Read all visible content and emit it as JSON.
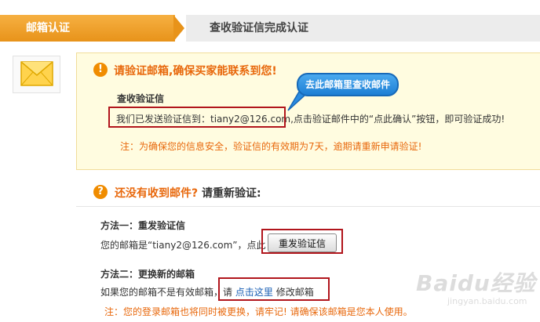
{
  "steps": {
    "step1": "邮箱认证",
    "step2": "查收验证信完成认证"
  },
  "notice": {
    "title": "请验证邮箱,确保买家能联系到您!",
    "sub_title": "查收验证信",
    "sent_prefix": "我们已发送验证信到：",
    "email": "tiany2@126.com",
    "sent_suffix": ",点击验证邮件中的“点此确认”按钮，即可验证成功!",
    "note": "注：为确保您的信息安全，验证信的有效期为7天，逾期请重新申请验证!",
    "callout": "去此邮箱里查收邮件"
  },
  "section2": {
    "title_orange": "还没有收到邮件?",
    "title_dark": "请重新验证:",
    "method1_title": "方法一：重发验证信",
    "method1_text": "您的邮箱是“tiany2@126.com”，点此",
    "resend_button": "重发验证信",
    "method2_title": "方法二：更换新的邮箱",
    "method2_prefix": "如果您的邮箱不是有效邮箱，请",
    "method2_link": "点击这里",
    "method2_suffix": "修改邮箱",
    "warning": "注：您的登录邮箱也将同时被更换，请牢记! 请确保该邮箱是您本人使用。"
  },
  "watermark": {
    "brand": "Baidu经验",
    "url": "jingyan.baidu.com"
  },
  "colors": {
    "step_active": "#f0a030",
    "accent_orange": "#e8680c",
    "highlight_red": "#b1151c",
    "callout_blue": "#2a8be0"
  }
}
